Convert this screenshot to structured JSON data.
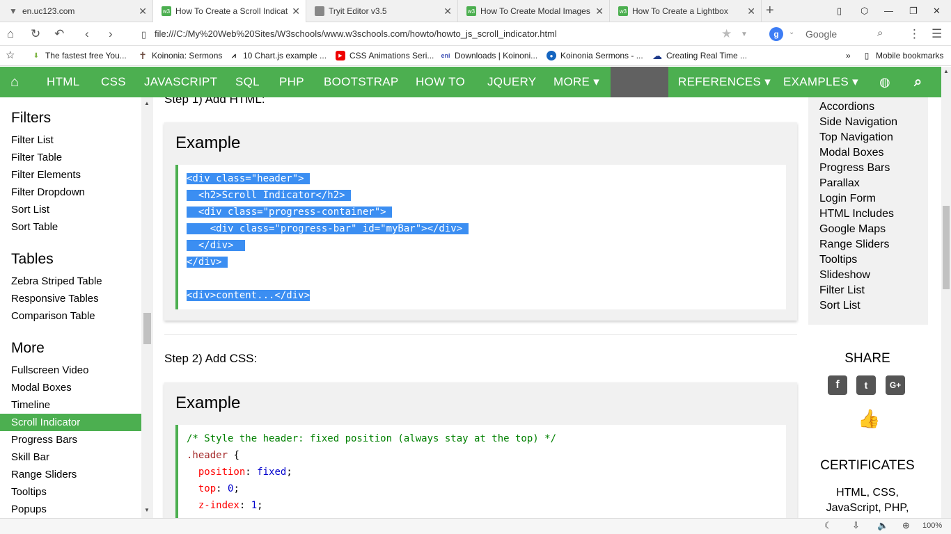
{
  "browser": {
    "tabs": [
      {
        "title": "en.uc123.com",
        "icon": "funnel-icon",
        "color": "#666666"
      },
      {
        "title": "How To Create a Scroll Indicat",
        "icon": "w3-icon",
        "color": "#4caf50"
      },
      {
        "title": "Tryit Editor v3.5",
        "icon": "page-icon",
        "color": "#888888"
      },
      {
        "title": "How To Create Modal Images",
        "icon": "w3-icon",
        "color": "#4caf50"
      },
      {
        "title": "How To Create a Lightbox",
        "icon": "w3-icon",
        "color": "#4caf50"
      }
    ],
    "url": "file:///C:/My%20Web%20Sites/W3schools/www.w3schools.com/howto/howto_js_scroll_indicator.html",
    "search_placeholder": "Google",
    "bookmarks": [
      "The fastest free You...",
      "Koinonia: Sermons",
      "10 Chart.js example ...",
      "CSS Animations Seri...",
      "Downloads | Koinoni...",
      "Koinonia Sermons - ...",
      "Creating Real Time ..."
    ],
    "bookmarks_more": "»",
    "mobile_bookmarks": "Mobile bookmarks",
    "zoom": "100%"
  },
  "topnav": {
    "items": [
      "HTML",
      "CSS",
      "JAVASCRIPT",
      "SQL",
      "PHP",
      "BOOTSTRAP",
      "HOW TO",
      "JQUERY",
      "MORE ▾",
      "REFERENCES ▾",
      "EXAMPLES ▾"
    ]
  },
  "sidebar": {
    "sections": [
      {
        "title": "Filters",
        "items": [
          "Filter List",
          "Filter Table",
          "Filter Elements",
          "Filter Dropdown",
          "Sort List",
          "Sort Table"
        ]
      },
      {
        "title": "Tables",
        "items": [
          "Zebra Striped Table",
          "Responsive Tables",
          "Comparison Table"
        ]
      },
      {
        "title": "More",
        "items": [
          "Fullscreen Video",
          "Modal Boxes",
          "Timeline",
          "Scroll Indicator",
          "Progress Bars",
          "Skill Bar",
          "Range Sliders",
          "Tooltips",
          "Popups"
        ]
      }
    ],
    "active": "Scroll Indicator"
  },
  "main": {
    "step1": "Step 1) Add HTML:",
    "step2": "Step 2) Add CSS:",
    "example_heading": "Example",
    "html_code": [
      "<div class=\"header\">",
      "  <h2>Scroll Indicator</h2>",
      "  <div class=\"progress-container\">",
      "    <div class=\"progress-bar\" id=\"myBar\"></div>",
      "  </div>",
      "</div>",
      "",
      "<div>content...</div>"
    ],
    "css_code": {
      "comment": "/* Style the header: fixed position (always stay at the top) */",
      "selector": ".header",
      "open_brace": " {",
      "props": [
        {
          "prop": "position",
          "value": "fixed"
        },
        {
          "prop": "top",
          "value": "0"
        },
        {
          "prop": "z-index",
          "value": "1"
        }
      ]
    }
  },
  "right": {
    "links": [
      "Accordions",
      "Side Navigation",
      "Top Navigation",
      "Modal Boxes",
      "Progress Bars",
      "Parallax",
      "Login Form",
      "HTML Includes",
      "Google Maps",
      "Range Sliders",
      "Tooltips",
      "Slideshow",
      "Filter List",
      "Sort List"
    ],
    "share_title": "SHARE",
    "certificates_title": "CERTIFICATES",
    "cert_lines": [
      "HTML, CSS,",
      "JavaScript, PHP,"
    ]
  },
  "colors": {
    "accent": "#4caf50",
    "selection": "#3b8ef2",
    "nav_dark": "#616161"
  }
}
